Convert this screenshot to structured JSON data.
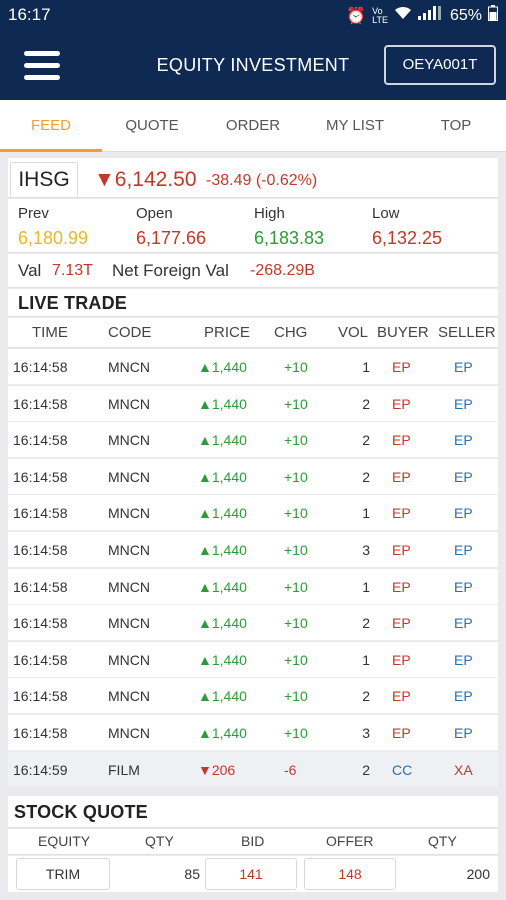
{
  "status": {
    "time": "16:17",
    "battery": "65%"
  },
  "header": {
    "title": "EQUITY INVESTMENT",
    "account": "OEYA001T"
  },
  "tabs": [
    "FEED",
    "QUOTE",
    "ORDER",
    "MY LIST",
    "TOP"
  ],
  "index": {
    "name": "IHSG",
    "price": "▼6,142.50",
    "change": "-38.49 (-0.62%)",
    "prev_label": "Prev",
    "prev": "6,180.99",
    "open_label": "Open",
    "open": "6,177.66",
    "high_label": "High",
    "high": "6,183.83",
    "low_label": "Low",
    "low": "6,132.25",
    "val_label": "Val",
    "val": "7.13T",
    "nf_label": "Net Foreign Val",
    "nf": "-268.29B"
  },
  "live_trade": {
    "title": "LIVE TRADE",
    "headers": [
      "TIME",
      "CODE",
      "PRICE",
      "CHG",
      "VOL",
      "BUYER",
      "SELLER"
    ],
    "rows": [
      {
        "time": "16:14:58",
        "code": "MNCN",
        "price": "▲1,440",
        "chg": "+10",
        "vol": "1",
        "buyer": "EP",
        "seller": "EP",
        "up": true
      },
      {
        "time": "16:14:58",
        "code": "MNCN",
        "price": "▲1,440",
        "chg": "+10",
        "vol": "2",
        "buyer": "EP",
        "seller": "EP",
        "up": true
      },
      {
        "time": "16:14:58",
        "code": "MNCN",
        "price": "▲1,440",
        "chg": "+10",
        "vol": "2",
        "buyer": "EP",
        "seller": "EP",
        "up": true
      },
      {
        "time": "16:14:58",
        "code": "MNCN",
        "price": "▲1,440",
        "chg": "+10",
        "vol": "2",
        "buyer": "EP",
        "seller": "EP",
        "up": true
      },
      {
        "time": "16:14:58",
        "code": "MNCN",
        "price": "▲1,440",
        "chg": "+10",
        "vol": "1",
        "buyer": "EP",
        "seller": "EP",
        "up": true
      },
      {
        "time": "16:14:58",
        "code": "MNCN",
        "price": "▲1,440",
        "chg": "+10",
        "vol": "3",
        "buyer": "EP",
        "seller": "EP",
        "up": true
      },
      {
        "time": "16:14:58",
        "code": "MNCN",
        "price": "▲1,440",
        "chg": "+10",
        "vol": "1",
        "buyer": "EP",
        "seller": "EP",
        "up": true
      },
      {
        "time": "16:14:58",
        "code": "MNCN",
        "price": "▲1,440",
        "chg": "+10",
        "vol": "2",
        "buyer": "EP",
        "seller": "EP",
        "up": true
      },
      {
        "time": "16:14:58",
        "code": "MNCN",
        "price": "▲1,440",
        "chg": "+10",
        "vol": "1",
        "buyer": "EP",
        "seller": "EP",
        "up": true
      },
      {
        "time": "16:14:58",
        "code": "MNCN",
        "price": "▲1,440",
        "chg": "+10",
        "vol": "2",
        "buyer": "EP",
        "seller": "EP",
        "up": true
      },
      {
        "time": "16:14:58",
        "code": "MNCN",
        "price": "▲1,440",
        "chg": "+10",
        "vol": "3",
        "buyer": "EP",
        "seller": "EP",
        "up": true
      },
      {
        "time": "16:14:59",
        "code": "FILM",
        "price": "▼206",
        "chg": "-6",
        "vol": "2",
        "buyer": "CC",
        "seller": "XA",
        "up": false
      }
    ]
  },
  "stock_quote": {
    "title": "STOCK QUOTE",
    "headers": [
      "EQUITY",
      "QTY",
      "BID",
      "OFFER",
      "QTY"
    ],
    "row": {
      "equity": "TRIM",
      "bid_qty": "85",
      "bid": "141",
      "offer": "148",
      "offer_qty": "200"
    }
  },
  "colors": {
    "navy": "#0e2a52",
    "accent": "#f0a030",
    "up": "#2e9b3a",
    "down": "#c0392b",
    "broker": "#2d6fa8"
  }
}
